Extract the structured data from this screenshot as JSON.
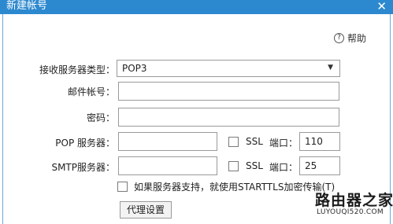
{
  "window": {
    "title": "新建帐号",
    "close_glyph": "✕"
  },
  "help": {
    "icon": "question-circle-icon",
    "icon_glyph": "?",
    "label": "帮助"
  },
  "form": {
    "server_type": {
      "label": "接收服务器类型：",
      "value": "POP3"
    },
    "email": {
      "label": "邮件帐号：",
      "value": ""
    },
    "password": {
      "label": "密码：",
      "value": ""
    },
    "pop": {
      "label": "POP 服务器：",
      "value": "",
      "ssl_label": "SSL",
      "ssl_checked": false,
      "port_label": "端口：",
      "port_value": "110"
    },
    "smtp": {
      "label": "SMTP服务器：",
      "value": "",
      "ssl_label": "SSL",
      "ssl_checked": false,
      "port_label": "端口：",
      "port_value": "25"
    },
    "starttls": {
      "label": "如果服务器支持，就使用STARTTLS加密传输(T)",
      "checked": false
    },
    "proxy_button": "代理设置"
  },
  "watermark": {
    "line1": "路由器之家",
    "line2": "LUYOUQI520.COM"
  },
  "colors": {
    "titlebar": "#2d89cf",
    "border": "#9a9a9a"
  }
}
